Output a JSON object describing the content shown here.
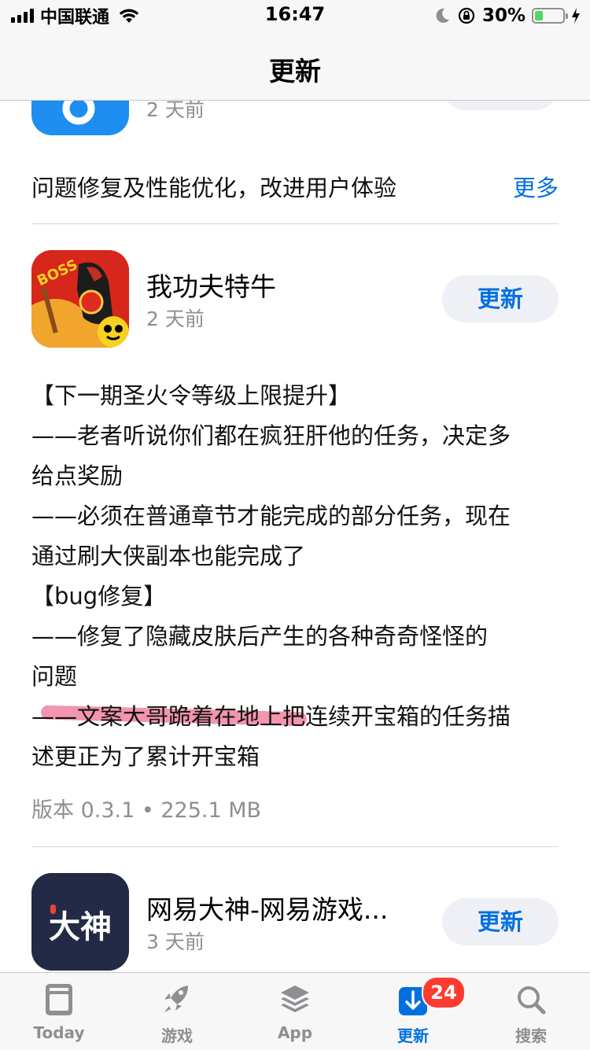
{
  "status_bar": {
    "carrier": "中国联通",
    "time": "16:47",
    "battery": "30%",
    "battery_level": 0.3
  },
  "nav": {
    "title": "更新"
  },
  "apps": [
    {
      "date": "2 天前",
      "notes_preview": "问题修复及性能优化，改进用户体验",
      "more": "更多",
      "icon_color": "#1e8ef0"
    },
    {
      "name": "我功夫特牛",
      "date": "2 天前",
      "button": "更新",
      "notes": [
        "【下一期圣火令等级上限提升】",
        "——老者听说你们都在疯狂肝他的任务，决定多",
        "给点奖励",
        "——必须在普通章节才能完成的部分任务，现在",
        "通过刷大侠副本也能完成了",
        "【bug修复】",
        "——修复了隐藏皮肤后产生的各种奇奇怪怪的",
        "问题",
        "——文案大哥跪着在地上把连续开宝箱的任务描",
        "述更正为了累计开宝箱"
      ],
      "icon_badge": "BOSS",
      "version": "版本 0.3.1 • 225.1 MB"
    },
    {
      "name": "网易大神-网易游戏...",
      "date": "3 天前",
      "button": "更新",
      "icon_text": "大神"
    }
  ],
  "tabs": [
    {
      "label": "Today",
      "icon": "today-icon"
    },
    {
      "label": "游戏",
      "icon": "rocket-icon"
    },
    {
      "label": "App",
      "icon": "layers-icon"
    },
    {
      "label": "更新",
      "icon": "download-icon",
      "active": true,
      "badge": "24"
    },
    {
      "label": "搜索",
      "icon": "search-icon"
    }
  ],
  "colors": {
    "accent": "#0070e0",
    "badge": "#ff3b30",
    "battery": "#4cd964"
  }
}
